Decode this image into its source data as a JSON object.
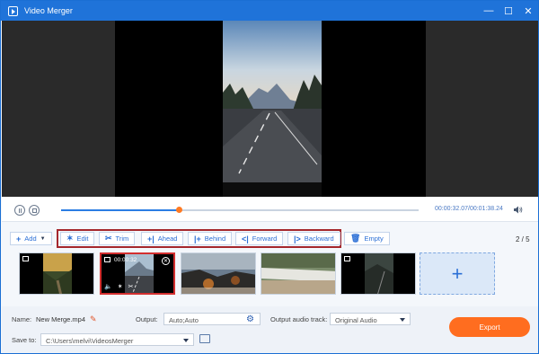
{
  "window": {
    "title": "Video Merger",
    "controls": [
      "—",
      "☐",
      "✕"
    ]
  },
  "player": {
    "current_time": "00:00:32.07",
    "total_time": "00:01:38.24",
    "progress": 0.33
  },
  "toolbar": {
    "add_label": "Add",
    "edit_label": "Edit",
    "trim_label": "Trim",
    "ahead_label": "Ahead",
    "behind_label": "Behind",
    "forward_label": "Forward",
    "backward_label": "Backward",
    "empty_label": "Empty",
    "counter_current": "2",
    "counter_total": "5"
  },
  "clips": {
    "selected_time": "00:00:32",
    "add_symbol": "+"
  },
  "bottom": {
    "name_label": "Name:",
    "name_value": "New Merge.mp4",
    "output_label": "Output:",
    "output_value": "Auto;Auto",
    "audio_label": "Output audio track:",
    "audio_value": "Original Audio",
    "save_label": "Save to:",
    "save_value": "C:\\Users\\melvi\\VideosMerger",
    "export_label": "Export"
  },
  "colors": {
    "accent": "#1f73d9",
    "export": "#ff6d1f",
    "highlight": "#a5272c"
  }
}
